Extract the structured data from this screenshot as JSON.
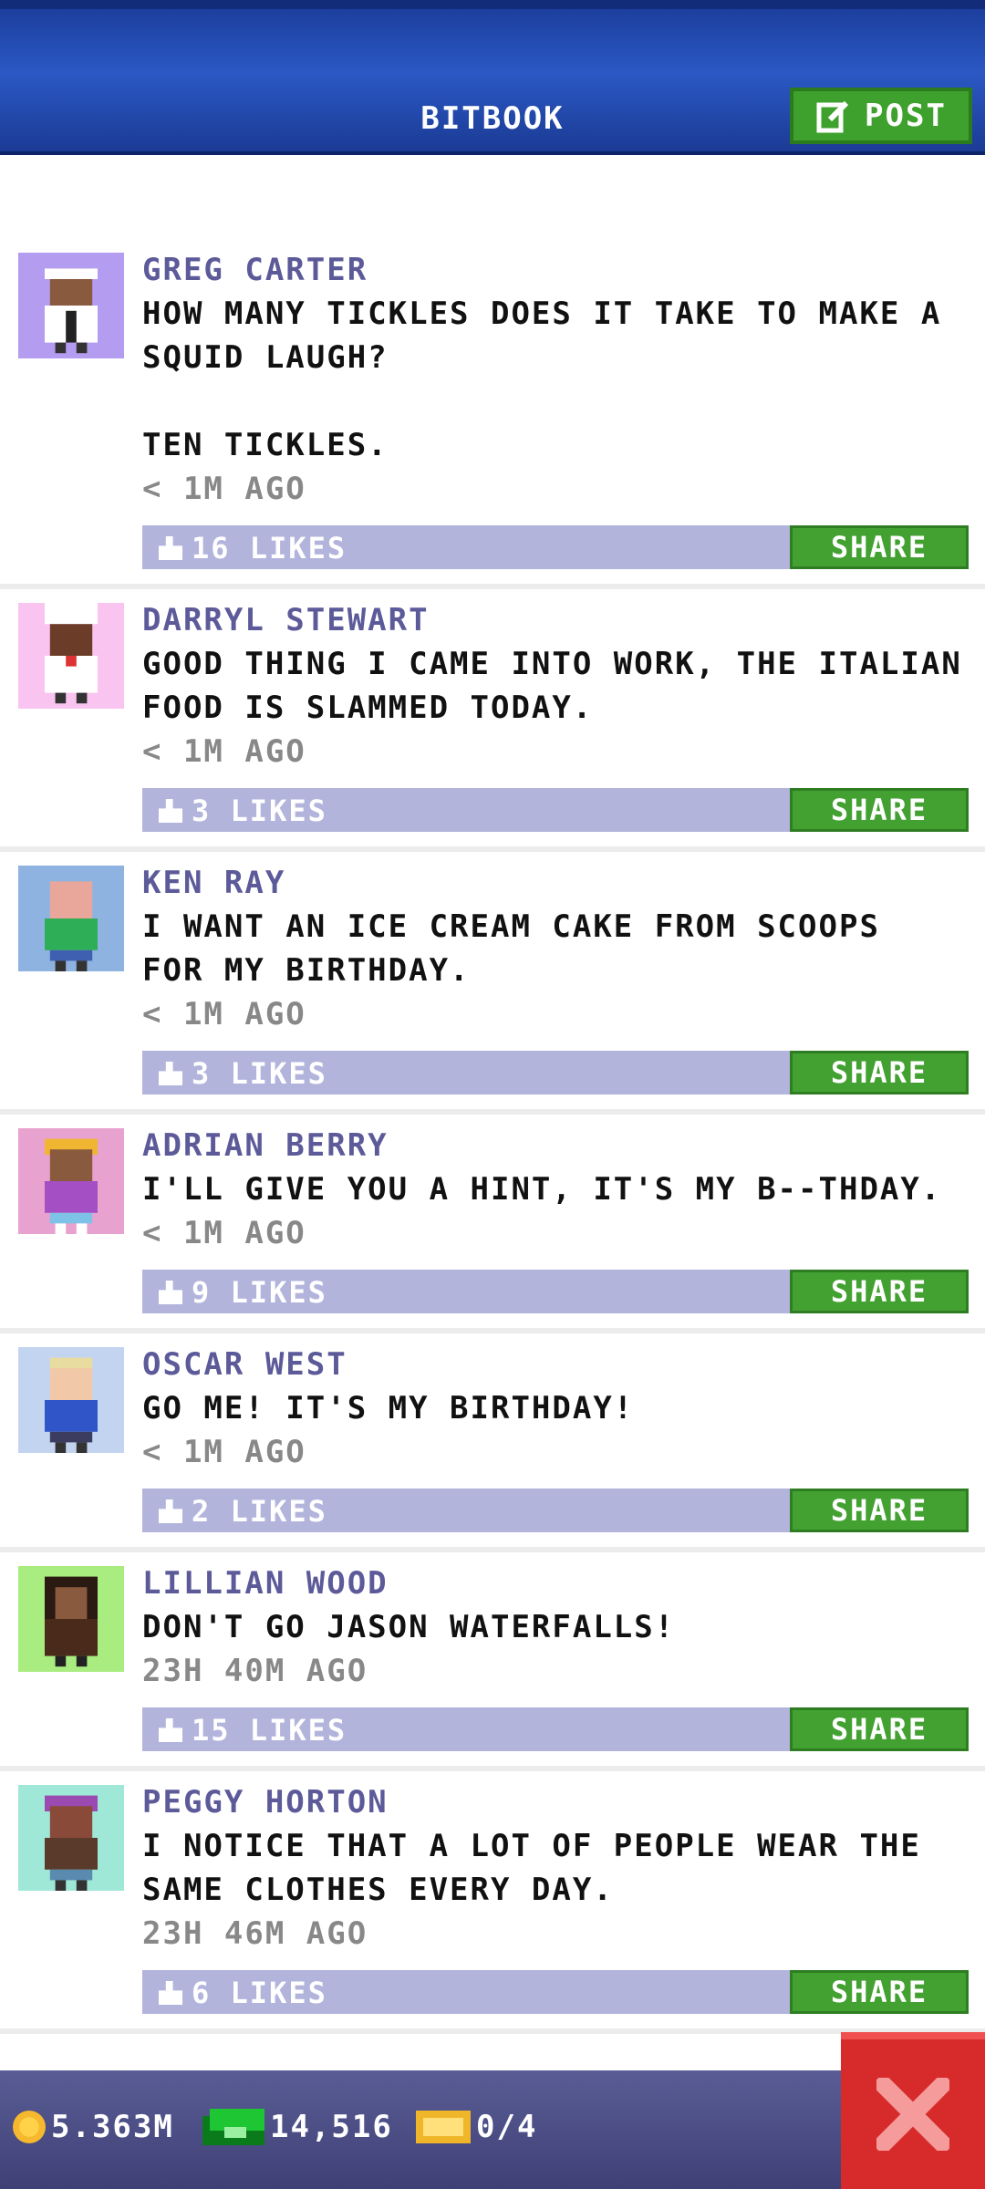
{
  "header": {
    "title": "BITBOOK",
    "post_label": "POST"
  },
  "posts": [
    {
      "author": "GREG CARTER",
      "text": "HOW MANY TICKLES DOES IT TAKE TO MAKE A\nSQUID LAUGH?\n\nTEN TICKLES.",
      "time": "< 1M AGO",
      "likes": "16 LIKES",
      "share": "SHARE",
      "avatar_bg": "#b49cf0"
    },
    {
      "author": "DARRYL STEWART",
      "text": "GOOD THING I CAME INTO WORK, THE ITALIAN\nFOOD IS SLAMMED TODAY.",
      "time": "< 1M AGO",
      "likes": "3 LIKES",
      "share": "SHARE",
      "avatar_bg": "#f9c4ef"
    },
    {
      "author": "KEN RAY",
      "text": "I WANT AN ICE CREAM CAKE FROM SCOOPS\nFOR MY BIRTHDAY.",
      "time": "< 1M AGO",
      "likes": "3 LIKES",
      "share": "SHARE",
      "avatar_bg": "#8fb3e0"
    },
    {
      "author": "ADRIAN BERRY",
      "text": "I'LL GIVE YOU A HINT, IT'S MY B--THDAY.",
      "time": "< 1M AGO",
      "likes": "9 LIKES",
      "share": "SHARE",
      "avatar_bg": "#e8a2cf"
    },
    {
      "author": "OSCAR WEST",
      "text": "GO ME! IT'S MY BIRTHDAY!",
      "time": "< 1M AGO",
      "likes": "2 LIKES",
      "share": "SHARE",
      "avatar_bg": "#c3d4f1"
    },
    {
      "author": "LILLIAN WOOD",
      "text": "DON'T GO JASON WATERFALLS!",
      "time": "23H 40M AGO",
      "likes": "15 LIKES",
      "share": "SHARE",
      "avatar_bg": "#a9ec80"
    },
    {
      "author": "PEGGY HORTON",
      "text": "I NOTICE THAT A LOT OF PEOPLE WEAR THE\nSAME CLOTHES EVERY DAY.",
      "time": "23H 46M AGO",
      "likes": "6 LIKES",
      "share": "SHARE",
      "avatar_bg": "#9fe8d8"
    }
  ],
  "bottom_bar": {
    "coins": "5.363M",
    "bux": "14,516",
    "tickets": "0/4"
  },
  "colors": {
    "header": "#2b58c4",
    "share": "#43a132",
    "likebar": "#b2b4dc",
    "author": "#5c5a99",
    "close": "#d72b2b"
  }
}
